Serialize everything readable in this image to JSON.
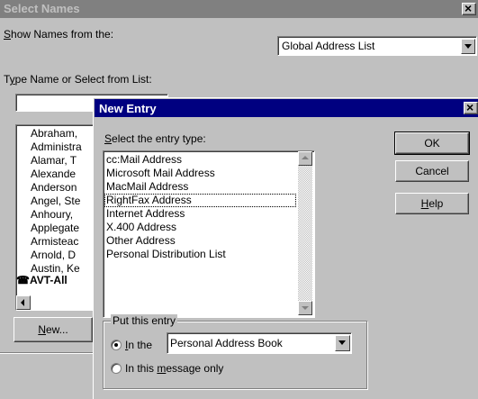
{
  "back_dialog": {
    "title": "Select Names",
    "close_glyph": "×",
    "show_names_label_prefix": "",
    "show_names_label_u": "S",
    "show_names_label_rest": "how Names from the:",
    "address_list_value": "Global Address List",
    "type_name_label_a": "T",
    "type_name_label_u": "y",
    "type_name_label_rest": "pe Name or Select from List:",
    "name_input_value": "",
    "names": [
      "Abraham,",
      "Administra",
      "Alamar, T",
      "Alexande",
      "Anderson",
      "Angel, Ste",
      "Anhoury,",
      "Applegate",
      "Armisteac",
      "Arnold, D",
      "Austin, Ke"
    ],
    "group_entry": "AVT-All",
    "new_button_u": "N",
    "new_button_rest": "ew..."
  },
  "new_entry": {
    "title": "New Entry",
    "close_glyph": "×",
    "select_label_u": "S",
    "select_label_rest": "elect the entry type:",
    "entry_types": [
      "cc:Mail Address",
      "Microsoft Mail Address",
      "MacMail Address",
      "RightFax Address",
      "Internet Address",
      "X.400 Address",
      "Other Address",
      "Personal Distribution List"
    ],
    "selected_index": 3,
    "ok_label": "OK",
    "cancel_label": "Cancel",
    "help_u": "H",
    "help_rest": "elp",
    "put_entry_label": "Put this entry",
    "in_the_u": "I",
    "in_the_rest": "n the",
    "book_value": "Personal Address Book",
    "in_message_a": "In this ",
    "in_message_u": "m",
    "in_message_rest": "essage only",
    "radio_selected": "in_the"
  },
  "colors": {
    "title_active": "#000080",
    "title_inactive": "#808080",
    "face": "#c0c0c0"
  }
}
